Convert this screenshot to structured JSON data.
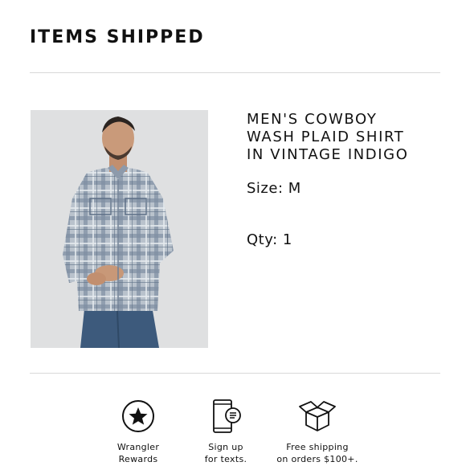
{
  "section": {
    "title": "ITEMS SHIPPED"
  },
  "item": {
    "name_lines": [
      "MEN'S COWBOY",
      "WASH PLAID SHIRT",
      "IN VINTAGE INDIGO"
    ],
    "size_text": "Size: M",
    "qty_text": "Qty: 1",
    "image_icon": "product-photo-plaid-shirt"
  },
  "perks": [
    {
      "icon": "star-circle-icon",
      "label_lines": [
        "Wrangler",
        "Rewards"
      ]
    },
    {
      "icon": "phone-chat-icon",
      "label_lines": [
        "Sign up",
        "for texts."
      ]
    },
    {
      "icon": "open-box-icon",
      "label_lines": [
        "Free shipping",
        "on orders $100+."
      ]
    }
  ],
  "colors": {
    "divider": "#d9d9d9",
    "text": "#111111",
    "photo_background": "#dfe0e1"
  }
}
